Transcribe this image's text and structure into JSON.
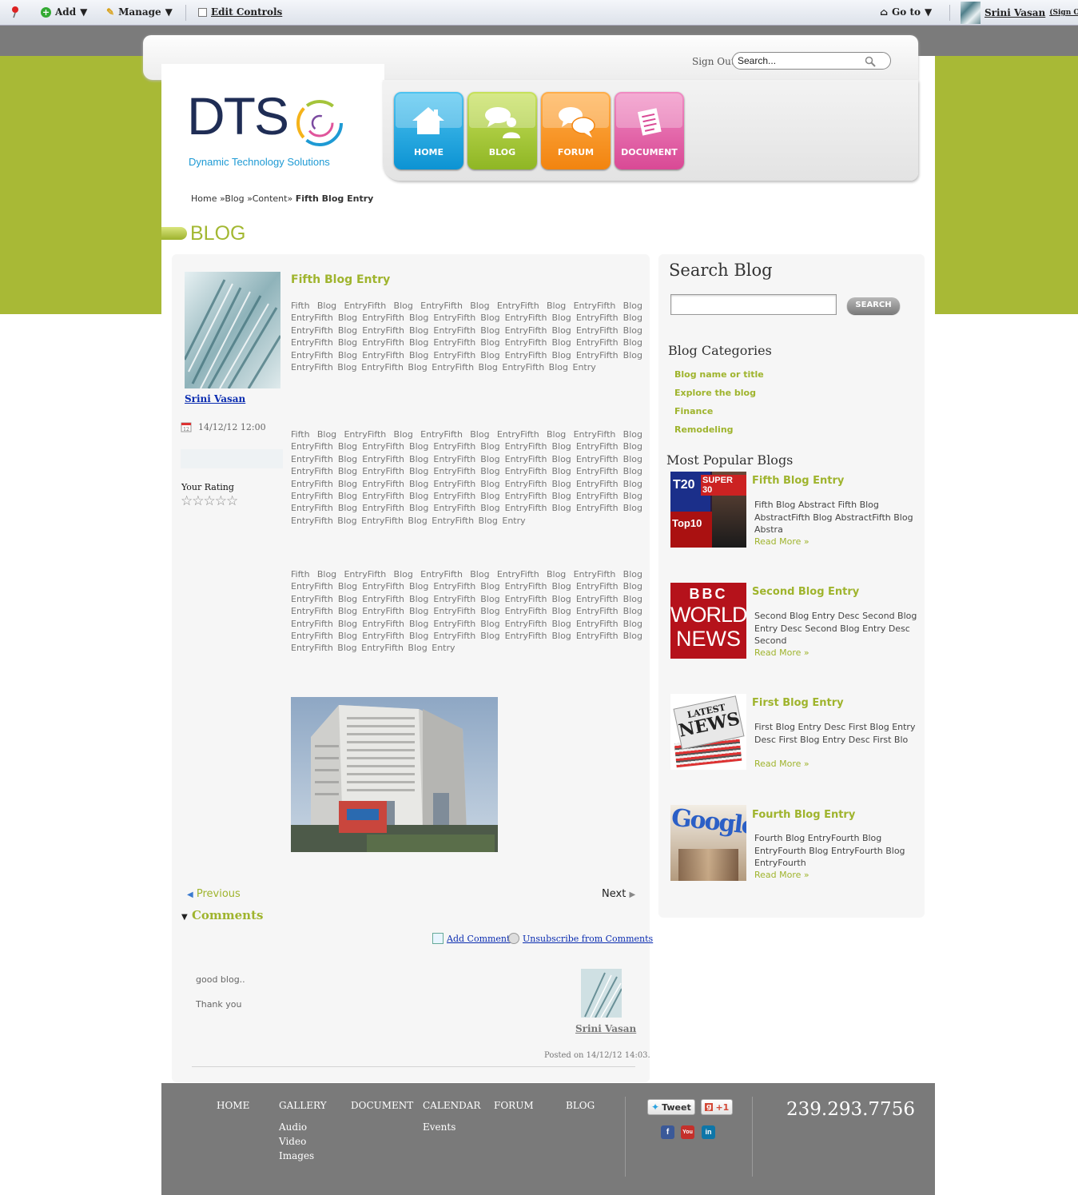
{
  "cms_bar": {
    "add_label": "Add",
    "manage_label": "Manage",
    "edit_controls_label": "Edit Controls",
    "goto_label": "Go to",
    "user_name": "Srini Vasan",
    "sign_out_label": "(Sign Out)"
  },
  "header": {
    "sign_out": "Sign Out",
    "search_placeholder": "Search...",
    "logo_text": "DTS",
    "logo_subtitle": "Dynamic Technology Solutions",
    "nav": [
      {
        "label": "HOME",
        "color": "#1aa3dd"
      },
      {
        "label": "BLOG",
        "color": "#98c12a"
      },
      {
        "label": "FORUM",
        "color": "#f5911f"
      },
      {
        "label": "DOCUMENT",
        "color": "#e0559b"
      }
    ]
  },
  "breadcrumb": {
    "items": [
      "Home",
      "Blog",
      "Content"
    ],
    "separator": "»",
    "current": "Fifth Blog Entry"
  },
  "page_title": "BLOG",
  "post": {
    "author": "Srini Vasan",
    "date": "14/12/12 12:00",
    "rating_label": "Your Rating",
    "stars": "☆☆☆☆☆",
    "title": "Fifth Blog Entry",
    "paragraphs": [
      "Fifth Blog EntryFifth Blog EntryFifth Blog EntryFifth Blog EntryFifth Blog EntryFifth Blog EntryFifth Blog EntryFifth Blog EntryFifth Blog EntryFifth Blog EntryFifth Blog EntryFifth Blog EntryFifth Blog EntryFifth Blog EntryFifth Blog EntryFifth Blog EntryFifth Blog EntryFifth Blog EntryFifth Blog EntryFifth Blog EntryFifth Blog EntryFifth Blog EntryFifth Blog EntryFifth Blog EntryFifth Blog EntryFifth Blog EntryFifth Blog EntryFifth Blog EntryFifth Blog Entry",
      "Fifth Blog EntryFifth Blog EntryFifth Blog EntryFifth Blog EntryFifth Blog EntryFifth Blog EntryFifth Blog EntryFifth Blog EntryFifth Blog EntryFifth Blog EntryFifth Blog EntryFifth Blog EntryFifth Blog EntryFifth Blog EntryFifth Blog EntryFifth Blog EntryFifth Blog EntryFifth Blog EntryFifth Blog EntryFifth Blog EntryFifth Blog EntryFifth Blog EntryFifth Blog EntryFifth Blog EntryFifth Blog EntryFifth Blog EntryFifth Blog EntryFifth Blog EntryFifth Blog EntryFifth Blog EntryFifth Blog EntryFifth Blog EntryFifth Blog EntryFifth Blog EntryFifth Blog EntryFifth Blog EntryFifth Blog EntryFifth Blog Entry",
      "Fifth Blog EntryFifth Blog EntryFifth Blog EntryFifth Blog EntryFifth Blog EntryFifth Blog EntryFifth Blog EntryFifth Blog EntryFifth Blog EntryFifth Blog EntryFifth Blog EntryFifth Blog EntryFifth Blog EntryFifth Blog EntryFifth Blog EntryFifth Blog EntryFifth Blog EntryFifth Blog EntryFifth Blog EntryFifth Blog EntryFifth Blog EntryFifth Blog EntryFifth Blog EntryFifth Blog EntryFifth Blog EntryFifth Blog EntryFifth Blog EntryFifth Blog EntryFifth Blog EntryFifth Blog EntryFifth Blog EntryFifth Blog Entry"
    ],
    "previous_label": "Previous",
    "next_label": "Next"
  },
  "comments": {
    "heading": "Comments",
    "add_comment": "Add Comment",
    "unsubscribe": "Unsubscribe from Comments",
    "items": [
      {
        "lines": [
          "good blog..",
          "Thank you"
        ],
        "author": "Srini Vasan",
        "posted": "Posted on 14/12/12 14:03."
      }
    ]
  },
  "sidebar": {
    "search_heading": "Search Blog",
    "search_button": "SEARCH",
    "categories_heading": "Blog Categories",
    "categories": [
      "Blog name or title",
      "Explore the blog",
      "Finance",
      "Remodeling"
    ],
    "popular_heading": "Most Popular Blogs",
    "popular": [
      {
        "title": "Fifth Blog Entry",
        "desc": "Fifth Blog Abstract Fifth Blog AbstractFifth Blog AbstractFifth Blog Abstra",
        "more": "Read More »",
        "thumb_text": [
          "T20",
          "SUPER 30",
          "Top10"
        ]
      },
      {
        "title": "Second Blog Entry",
        "desc": "Second Blog Entry Desc Second Blog Entry Desc Second Blog Entry Desc Second",
        "more": "Read More »",
        "thumb_text": [
          "BBC",
          "WORLD",
          "NEWS"
        ]
      },
      {
        "title": "First Blog Entry",
        "desc": "First Blog Entry Desc First Blog Entry Desc First Blog Entry Desc First Blo",
        "more": "Read More »",
        "thumb_text": [
          "LATEST",
          "NEWS"
        ]
      },
      {
        "title": "Fourth Blog Entry",
        "desc": "Fourth Blog EntryFourth Blog EntryFourth Blog EntryFourth Blog EntryFourth",
        "more": "Read More »",
        "thumb_text": [
          "Google"
        ]
      }
    ]
  },
  "footer": {
    "nav": [
      "HOME",
      "GALLERY",
      "DOCUMENT",
      "CALENDAR",
      "FORUM",
      "BLOG"
    ],
    "gallery_sub": [
      "Audio",
      "Video",
      "Images"
    ],
    "calendar_sub": [
      "Events"
    ],
    "tweet_label": "Tweet",
    "plus_one_label": "+1",
    "phone": "239.293.7756"
  },
  "colors": {
    "accent_green": "#a3b832",
    "band_green": "#a8b936",
    "footer_gray": "#7a7a7a",
    "link_blue": "#0a2cb0"
  }
}
